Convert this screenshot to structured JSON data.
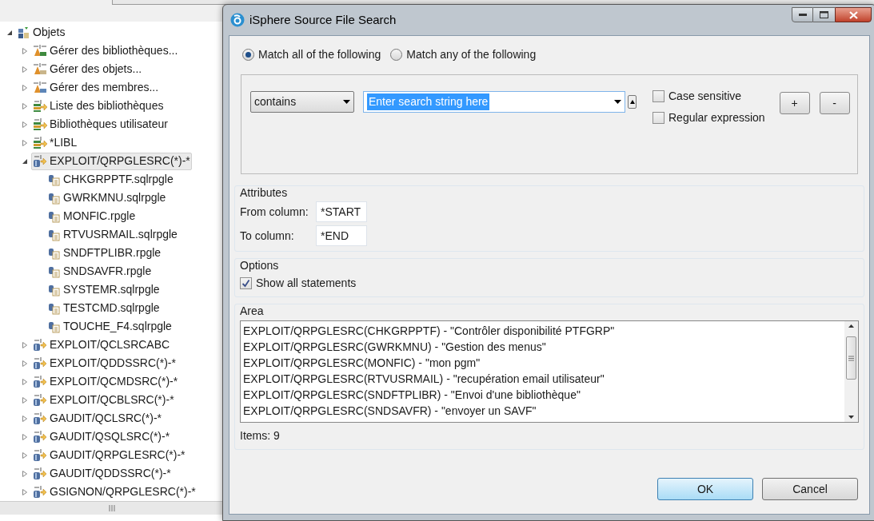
{
  "tree": {
    "items": [
      {
        "label": "Objets",
        "kind": "root",
        "expanded": true,
        "selected": false,
        "children": [
          {
            "label": "Gérer des bibliothèques...",
            "kind": "library-action",
            "expanded": false,
            "selected": false
          },
          {
            "label": "Gérer des objets...",
            "kind": "object-action",
            "expanded": false,
            "selected": false
          },
          {
            "label": "Gérer des membres...",
            "kind": "member-action",
            "expanded": false,
            "selected": false
          },
          {
            "label": "Liste des bibliothèques",
            "kind": "list",
            "expanded": false,
            "selected": false
          },
          {
            "label": "Bibliothèques utilisateur",
            "kind": "list",
            "expanded": false,
            "selected": false
          },
          {
            "label": "*LIBL",
            "kind": "list",
            "expanded": false,
            "selected": false
          },
          {
            "label": "EXPLOIT/QRPGLESRC(*)-*",
            "kind": "filter",
            "expanded": true,
            "selected": true,
            "children": [
              {
                "label": "CHKGRPPTF.sqlrpgle",
                "kind": "member",
                "selected": false
              },
              {
                "label": "GWRKMNU.sqlrpgle",
                "kind": "member",
                "selected": false
              },
              {
                "label": "MONFIC.rpgle",
                "kind": "member",
                "selected": false
              },
              {
                "label": "RTVUSRMAIL.sqlrpgle",
                "kind": "member",
                "selected": false
              },
              {
                "label": "SNDFTPLIBR.rpgle",
                "kind": "member",
                "selected": false
              },
              {
                "label": "SNDSAVFR.rpgle",
                "kind": "member",
                "selected": false
              },
              {
                "label": "SYSTEMR.sqlrpgle",
                "kind": "member",
                "selected": false
              },
              {
                "label": "TESTCMD.sqlrpgle",
                "kind": "member",
                "selected": false
              },
              {
                "label": "TOUCHE_F4.sqlrpgle",
                "kind": "member",
                "selected": false
              }
            ]
          },
          {
            "label": "EXPLOIT/QCLSRCABC",
            "kind": "filter",
            "expanded": false,
            "selected": false
          },
          {
            "label": "EXPLOIT/QDDSSRC(*)-*",
            "kind": "filter",
            "expanded": false,
            "selected": false
          },
          {
            "label": "EXPLOIT/QCMDSRC(*)-*",
            "kind": "filter",
            "expanded": false,
            "selected": false
          },
          {
            "label": "EXPLOIT/QCBLSRC(*)-*",
            "kind": "filter",
            "expanded": false,
            "selected": false
          },
          {
            "label": "GAUDIT/QCLSRC(*)-*",
            "kind": "filter",
            "expanded": false,
            "selected": false
          },
          {
            "label": "GAUDIT/QSQLSRC(*)-*",
            "kind": "filter",
            "expanded": false,
            "selected": false
          },
          {
            "label": "GAUDIT/QRPGLESRC(*)-*",
            "kind": "filter",
            "expanded": false,
            "selected": false
          },
          {
            "label": "GAUDIT/QDDSSRC(*)-*",
            "kind": "filter",
            "expanded": false,
            "selected": false
          },
          {
            "label": "GSIGNON/QRPGLESRC(*)-*",
            "kind": "filter",
            "expanded": false,
            "selected": false
          }
        ]
      }
    ]
  },
  "dialog": {
    "title": "iSphere Source File Search",
    "match_options": [
      {
        "label": "Match all of the following",
        "selected": true
      },
      {
        "label": "Match any of the following",
        "selected": false
      }
    ],
    "criterion": {
      "operator": "contains",
      "value": "Enter search string here",
      "value_selected": true
    },
    "criterion_checkboxes": [
      {
        "label": "Case sensitive",
        "checked": false
      },
      {
        "label": "Regular expression",
        "checked": false
      }
    ],
    "criterion_buttons": [
      "+",
      "-"
    ],
    "attributes": {
      "title": "Attributes",
      "fields": [
        {
          "label": "From column:",
          "value": "*START"
        },
        {
          "label": "To column:",
          "value": "*END"
        }
      ]
    },
    "options": {
      "title": "Options",
      "checkboxes": [
        {
          "label": "Show all statements",
          "checked": true
        }
      ]
    },
    "area": {
      "title": "Area",
      "items": [
        "EXPLOIT/QRPGLESRC(CHKGRPPTF) - \"Contrôler disponibilité PTFGRP\"",
        "EXPLOIT/QRPGLESRC(GWRKMNU) - \"Gestion des menus\"",
        "EXPLOIT/QRPGLESRC(MONFIC) - \"mon pgm\"",
        "EXPLOIT/QRPGLESRC(RTVUSRMAIL) - \"recupération email utilisateur\"",
        "EXPLOIT/QRPGLESRC(SNDFTPLIBR) - \"Envoi d'une bibliothèque\"",
        "EXPLOIT/QRPGLESRC(SNDSAVFR) - \"envoyer un SAVF\""
      ],
      "count": "Items: 9"
    },
    "buttons": [
      {
        "label": "OK",
        "default": true
      },
      {
        "label": "Cancel",
        "default": false
      }
    ]
  }
}
